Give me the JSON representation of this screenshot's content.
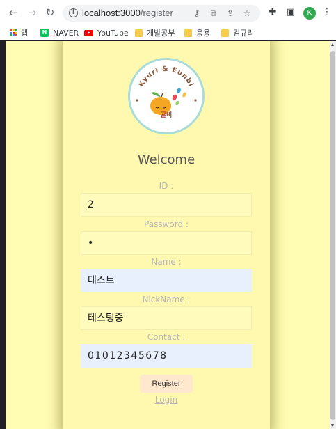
{
  "browser": {
    "url_host": "localhost:3000",
    "url_path": "/register",
    "profile_initial": "K"
  },
  "bookmarks": [
    {
      "label": "앱",
      "icon": "apps-grid-icon"
    },
    {
      "label": "NAVER",
      "icon": "naver-icon",
      "badge": "N"
    },
    {
      "label": "YouTube",
      "icon": "youtube-icon"
    },
    {
      "label": "개발공부",
      "icon": "folder-icon"
    },
    {
      "label": "응용",
      "icon": "folder-icon"
    },
    {
      "label": "김규리",
      "icon": "folder-icon"
    }
  ],
  "logo": {
    "arc_text": "Kyuri & Eunbi",
    "kor_text": "귤비"
  },
  "form": {
    "welcome": "Welcome",
    "id_label": "ID :",
    "id_value": "2",
    "password_label": "Password :",
    "password_value": "•",
    "name_label": "Name :",
    "name_value": "테스트",
    "nickname_label": "NickName :",
    "nickname_value": "테스팅중",
    "contact_label": "Contact :",
    "contact_value": "01012345678",
    "register_label": "Register",
    "login_label": "Login"
  },
  "colors": {
    "page_bg": "#fffdb3",
    "card_bg": "#fff9b0",
    "autofill_bg": "#e8f0fe",
    "button_bg": "#ffe8cc"
  }
}
